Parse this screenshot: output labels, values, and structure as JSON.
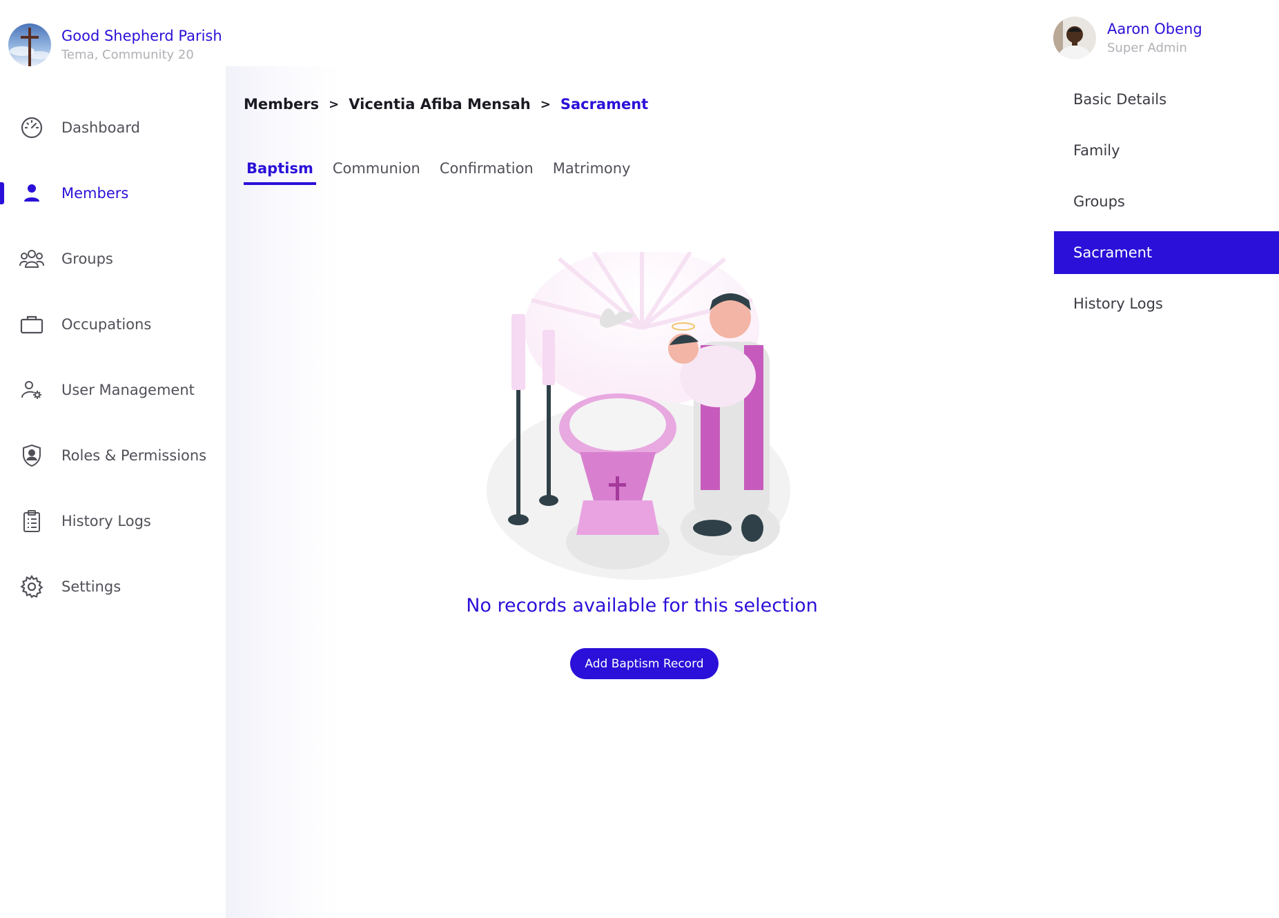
{
  "org": {
    "name": "Good Shepherd Parish",
    "location": "Tema, Community 20"
  },
  "user": {
    "name": "Aaron Obeng",
    "role": "Super Admin"
  },
  "sidebar": {
    "items": [
      {
        "label": "Dashboard",
        "icon": "dashboard-gauge-icon",
        "active": false
      },
      {
        "label": "Members",
        "icon": "person-icon",
        "active": true
      },
      {
        "label": "Groups",
        "icon": "group-icon",
        "active": false
      },
      {
        "label": "Occupations",
        "icon": "briefcase-icon",
        "active": false
      },
      {
        "label": "User Management",
        "icon": "user-gear-icon",
        "active": false
      },
      {
        "label": "Roles & Permissions",
        "icon": "shield-user-icon",
        "active": false
      },
      {
        "label": "History Logs",
        "icon": "clipboard-list-icon",
        "active": false
      },
      {
        "label": "Settings",
        "icon": "gear-icon",
        "active": false
      }
    ]
  },
  "breadcrumb": {
    "items": [
      "Members",
      "Vicentia Afiba Mensah",
      "Sacrament"
    ],
    "separator": ">"
  },
  "tabs": [
    {
      "label": "Baptism",
      "active": true
    },
    {
      "label": "Communion",
      "active": false
    },
    {
      "label": "Confirmation",
      "active": false
    },
    {
      "label": "Matrimony",
      "active": false
    }
  ],
  "empty_state": {
    "message": "No records available for this selection",
    "button_label": "Add Baptism Record"
  },
  "right_panel": {
    "items": [
      {
        "label": "Basic Details",
        "active": false
      },
      {
        "label": "Family",
        "active": false
      },
      {
        "label": "Groups",
        "active": false
      },
      {
        "label": "Sacrament",
        "active": true
      },
      {
        "label": "History Logs",
        "active": false
      }
    ]
  },
  "colors": {
    "accent": "#2a10d8",
    "muted_text": "#b0b0b6",
    "illustration_pink": "#d96bd0"
  }
}
